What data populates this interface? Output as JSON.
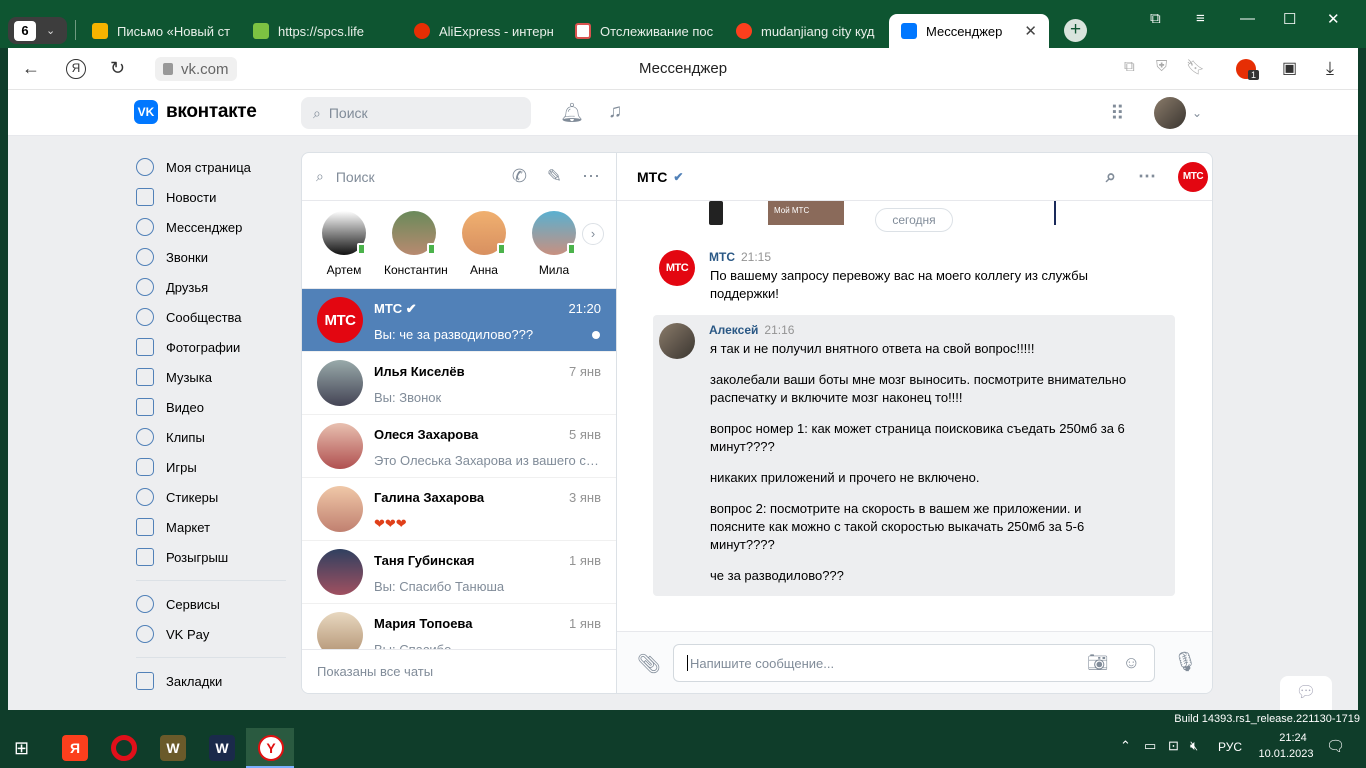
{
  "browser": {
    "tab_count": "6",
    "tabs": [
      {
        "label": "Письмо «Новый ст",
        "color": "#f6b400"
      },
      {
        "label": "https://spcs.life",
        "color": "#7cc242"
      },
      {
        "label": "AliExpress - интерн",
        "color": "#e62e04"
      },
      {
        "label": "Отслеживание пос",
        "color": "#ffffff"
      },
      {
        "label": "mudanjiang city куд",
        "color": "#fc3f1d"
      },
      {
        "label": "Мессенджер",
        "color": "#0077ff"
      }
    ],
    "url": "vk.com",
    "page_title": "Мессенджер",
    "ext_badge": "1"
  },
  "vk": {
    "logo_text": "вконтакте",
    "logo_mark": "VK",
    "search_placeholder": "Поиск",
    "nav": [
      "Моя страница",
      "Новости",
      "Мессенджер",
      "Звонки",
      "Друзья",
      "Сообщества",
      "Фотографии",
      "Музыка",
      "Видео",
      "Клипы",
      "Игры",
      "Стикеры",
      "Маркет",
      "Розыгрыш"
    ],
    "nav2": [
      "Сервисы",
      "VK Pay"
    ],
    "nav3": [
      "Закладки"
    ]
  },
  "chatlist": {
    "search_placeholder": "Поиск",
    "stories": [
      "Артем",
      "Константин",
      "Анна",
      "Мила"
    ],
    "chats": [
      {
        "name": "МТС ✔",
        "preview": "Вы: че за разводилово???",
        "time": "21:20"
      },
      {
        "name": "Илья Киселёв",
        "preview": "Вы: Звонок",
        "time": "7 янв"
      },
      {
        "name": "Олеся Захарова",
        "preview": "Это Олеська Захарова из вашего спи...",
        "time": "5 янв"
      },
      {
        "name": "Галина Захарова",
        "preview": "❤❤❤",
        "time": "3 янв"
      },
      {
        "name": "Таня Губинская",
        "preview": "Вы: Спасибо Танюша",
        "time": "1 янв"
      },
      {
        "name": "Мария Топоева",
        "preview": "Вы: Спасибо",
        "time": "1 янв"
      }
    ],
    "footer": "Показаны все чаты"
  },
  "chat": {
    "title": "МТС",
    "mts_logo": "МТС",
    "attach_caption": "Мой МТС",
    "date_pill": "сегодня",
    "messages": [
      {
        "author": "МТС",
        "time": "21:15",
        "text": "По вашему запросу перевожу вас на моего коллегу из службы поддержки!"
      },
      {
        "author": "Алексей",
        "time": "21:16",
        "lines": [
          "я так и не получил внятного ответа на свой вопрос!!!!!",
          "заколебали ваши боты мне мозг выносить. посмотрите внимательно распечатку и включите мозг наконец то!!!!",
          "вопрос номер 1: как может страница поисковика съедать 250мб за 6 минут????",
          "никаких приложений и прочего не включено.",
          "вопрос 2: посмотрите на скорость в вашем же приложении. и поясните как можно с такой скоростью выкачать 250мб за 5-6 минут????",
          "че за разводилово???"
        ]
      }
    ],
    "composer_placeholder": "Напишите сообщение..."
  },
  "os": {
    "build": "Build 14393.rs1_release.221130-1719",
    "lang": "РУС",
    "time": "21:24",
    "date": "10.01.2023"
  }
}
